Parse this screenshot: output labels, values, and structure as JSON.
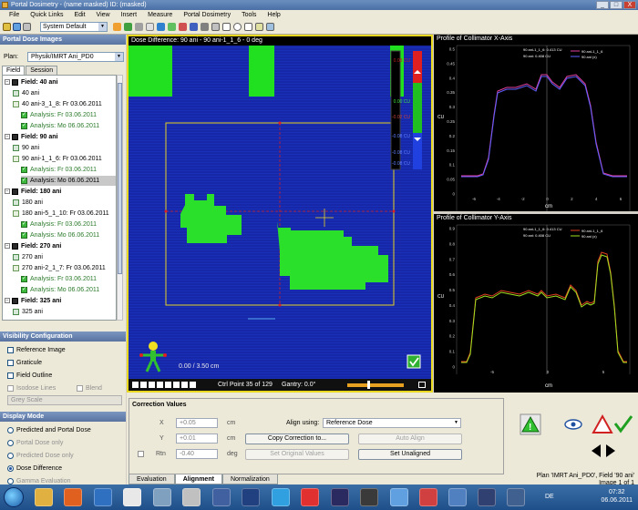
{
  "window": {
    "title": "Portal Dosimetry - (name masked) ID: (masked)",
    "controls": [
      "_",
      "□",
      "X"
    ]
  },
  "menu": [
    "File",
    "Quick Links",
    "Edit",
    "View",
    "Insert",
    "Measure",
    "Portal Dosimetry",
    "Tools",
    "Help"
  ],
  "toolbar": {
    "workspace_select": "System Default"
  },
  "left_panel": {
    "header": "Portal Dose Images",
    "plan_label": "Plan:",
    "plan_value": "Physik/IMRT Ani_PD0",
    "tabs": [
      "Field",
      "Session"
    ],
    "tree": [
      {
        "text": "Field: 40 ani",
        "icon": "field-icon",
        "level": 0
      },
      {
        "text": "40 ani",
        "icon": "image-icon",
        "level": 1
      },
      {
        "text": "40 ani-3_1_8: Fr 03.06.2011",
        "icon": "dose-icon",
        "level": 1
      },
      {
        "text": "Analysis: Fr 03.06.2011",
        "icon": "check-icon",
        "level": 2,
        "green": true
      },
      {
        "text": "Analysis: Mo 06.06.2011",
        "icon": "check-icon",
        "level": 2,
        "green": true
      },
      {
        "text": "Field: 90 ani",
        "icon": "field-icon",
        "level": 0
      },
      {
        "text": "90 ani",
        "icon": "image-icon",
        "level": 1
      },
      {
        "text": "90 ani-1_1_6: Fr 03.06.2011",
        "icon": "dose-icon",
        "level": 1
      },
      {
        "text": "Analysis: Fr 03.06.2011",
        "icon": "check-icon",
        "level": 2,
        "green": true
      },
      {
        "text": "Analysis: Mo 06.06.2011",
        "icon": "check-icon",
        "level": 2,
        "green": false,
        "selected": true
      },
      {
        "text": "Field: 180 ani",
        "icon": "field-icon",
        "level": 0
      },
      {
        "text": "180 ani",
        "icon": "image-icon",
        "level": 1
      },
      {
        "text": "180 ani-5_1_10: Fr 03.06.2011",
        "icon": "dose-icon",
        "level": 1
      },
      {
        "text": "Analysis: Fr 03.06.2011",
        "icon": "check-icon",
        "level": 2,
        "green": true
      },
      {
        "text": "Analysis: Mo 06.06.2011",
        "icon": "check-icon",
        "level": 2,
        "green": true
      },
      {
        "text": "Field: 270 ani",
        "icon": "field-icon",
        "level": 0
      },
      {
        "text": "270 ani",
        "icon": "image-icon",
        "level": 1
      },
      {
        "text": "270 ani-2_1_7: Fr 03.06.2011",
        "icon": "dose-icon",
        "level": 1
      },
      {
        "text": "Analysis: Fr 03.06.2011",
        "icon": "check-icon",
        "level": 2,
        "green": true
      },
      {
        "text": "Analysis: Mo 06.06.2011",
        "icon": "check-icon",
        "level": 2,
        "green": true
      },
      {
        "text": "Field: 325 ani",
        "icon": "field-icon",
        "level": 0
      },
      {
        "text": "325 ani",
        "icon": "image-icon",
        "level": 1
      }
    ],
    "visibility": {
      "header": "Visibility Configuration",
      "reference_image": "Reference Image",
      "graticule": "Graticule",
      "field_outline": "Field Outline",
      "isodose_lines": "Isodose Lines",
      "blend": "Blend",
      "color_scheme": "Grey Scale"
    },
    "display_mode": {
      "header": "Display Mode",
      "options": [
        "Predicted and Portal Dose",
        "Portal Dose only",
        "Predicted Dose only",
        "Dose Difference",
        "Gamma Evaluation"
      ],
      "selected": "Dose Difference"
    }
  },
  "image_panel": {
    "title": "Dose Difference: 90 ani - 90 ani-1_1_6 - 0 deg",
    "colorbar_labels": [
      "0.08 CU",
      "0.00 CU",
      "-0.02 CU",
      "-0.08 CU",
      "-0.08 CU",
      "-0.08 CU"
    ],
    "readout": "0.00 /   3.50 cm",
    "ctrl_point": "Ctrl Point 35 of 129",
    "gantry": "Gantry: 0.0°"
  },
  "graph_x": {
    "title": "Profile of Collimator X-Axis",
    "legend": [
      "90 ani-1_1_6",
      "90 ani (x)"
    ],
    "readout": [
      "90 ani-1_1_6: 0.413 CU",
      "90 ani: 0.408 CU"
    ],
    "x_label": "cm",
    "y_label": "CU",
    "x_ticks": [
      "-6",
      "-4",
      "-2",
      "0",
      "2",
      "4",
      "6"
    ],
    "y_ticks": [
      "0.5",
      "0.45",
      "0.4",
      "0.35",
      "0.3",
      "0.25",
      "0.2",
      "0.15",
      "0.1",
      "0.05",
      "0"
    ],
    "colors": {
      "measured": "#e040a0",
      "predicted": "#6060ff"
    }
  },
  "graph_y": {
    "title": "Profile of Collimator Y-Axis",
    "legend": [
      "90 ani-1_1_6",
      "90 ani (x)"
    ],
    "readout": [
      "90 ani-1_1_6: 0.413 CU",
      "90 ani: 0.408 CU"
    ],
    "x_label": "cm",
    "y_label": "CU",
    "x_ticks": [
      "-5",
      "0",
      "5"
    ],
    "y_ticks": [
      "0.9",
      "0.8",
      "0.7",
      "0.6",
      "0.5",
      "0.4",
      "0.3",
      "0.2",
      "0.1",
      "0"
    ],
    "colors": {
      "measured": "#e04020",
      "predicted": "#a0e020"
    }
  },
  "correction": {
    "title": "Correction Values",
    "x_label": "X",
    "x_value": "+0.05",
    "y_label": "Y",
    "y_value": "+0.01",
    "rtn_label": "Rtn",
    "rtn_value": "-0.40",
    "unit_cm": "cm",
    "unit_deg": "deg",
    "align_using_label": "Align using:",
    "align_using_value": "Reference Dose",
    "copy_button": "Copy Correction to...",
    "auto_align_button": "Auto Align",
    "set_original_button": "Set Original Values",
    "set_unaligned_button": "Set Unaligned"
  },
  "bottom_tabs": [
    "Evaluation",
    "Alignment",
    "Normalization"
  ],
  "status": {
    "plan": "Plan 'IMRT Ani_PD0', Field '90 ani'",
    "image": "Image 1 of 1"
  },
  "taskbar": {
    "lang": "DE",
    "time": "07:32",
    "date": "06.06.2011"
  }
}
